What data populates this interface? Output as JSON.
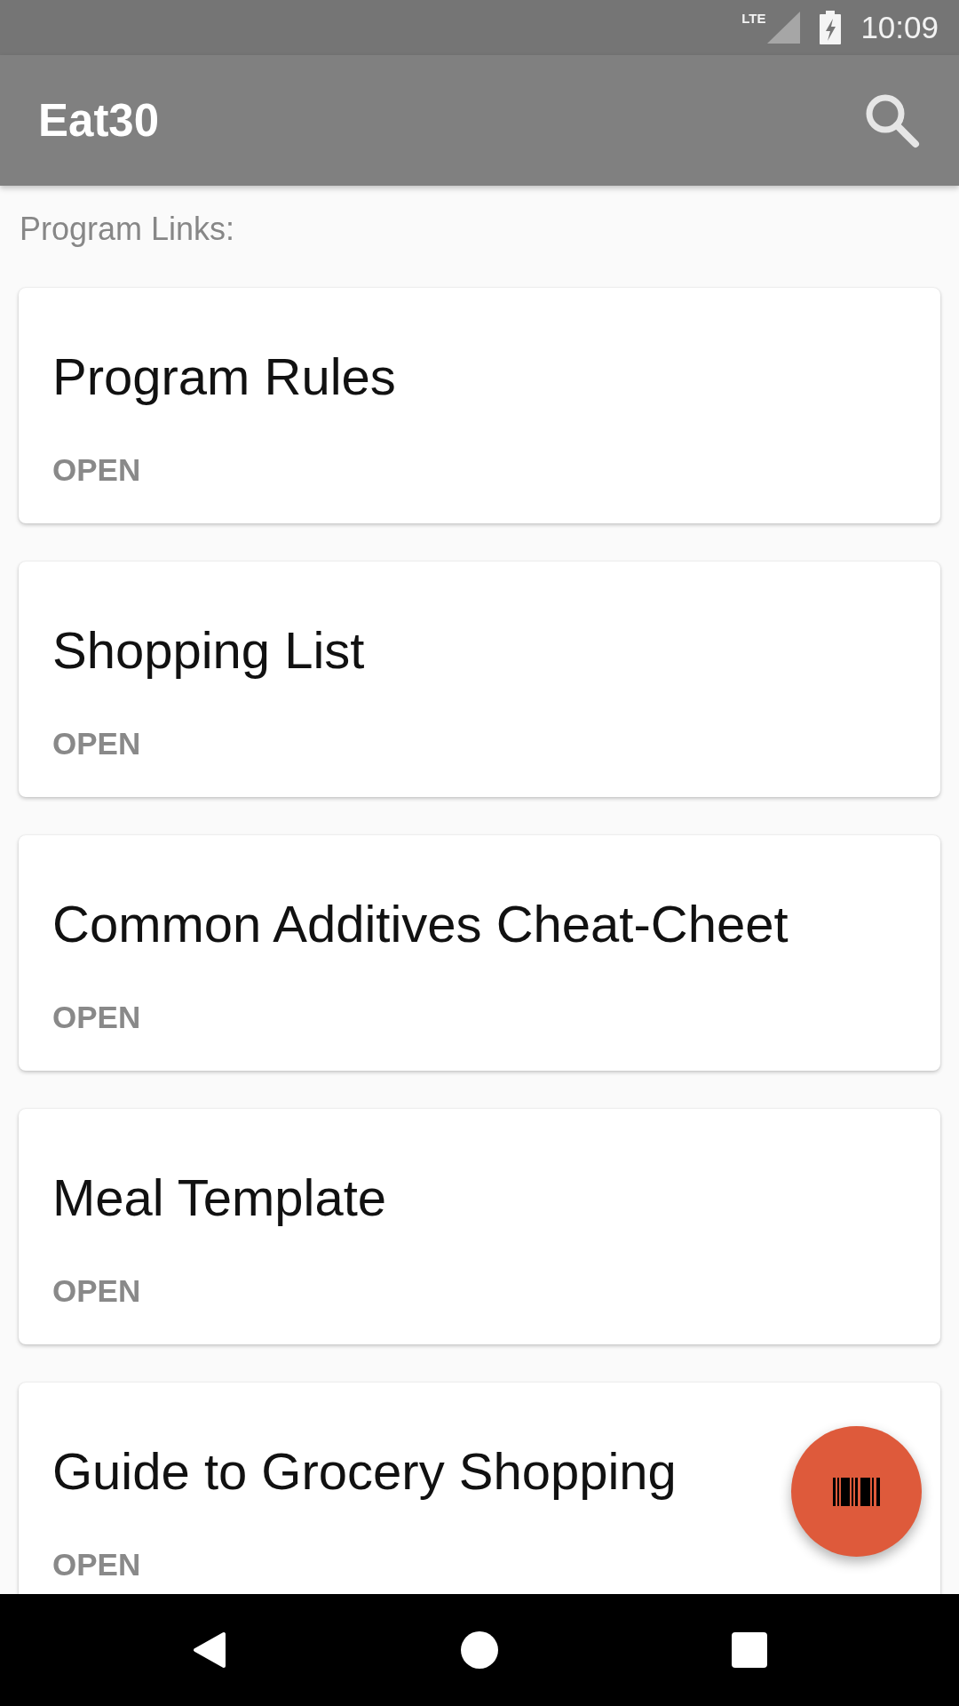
{
  "status_bar": {
    "network": "LTE",
    "time": "10:09"
  },
  "app_bar": {
    "title": "Eat30"
  },
  "section_label": "Program Links:",
  "cards": [
    {
      "title": "Program Rules",
      "action": "OPEN"
    },
    {
      "title": "Shopping List",
      "action": "OPEN"
    },
    {
      "title": "Common Additives Cheat-Cheet",
      "action": "OPEN"
    },
    {
      "title": "Meal Template",
      "action": "OPEN"
    },
    {
      "title": "Guide to Grocery Shopping",
      "action": "OPEN"
    }
  ]
}
